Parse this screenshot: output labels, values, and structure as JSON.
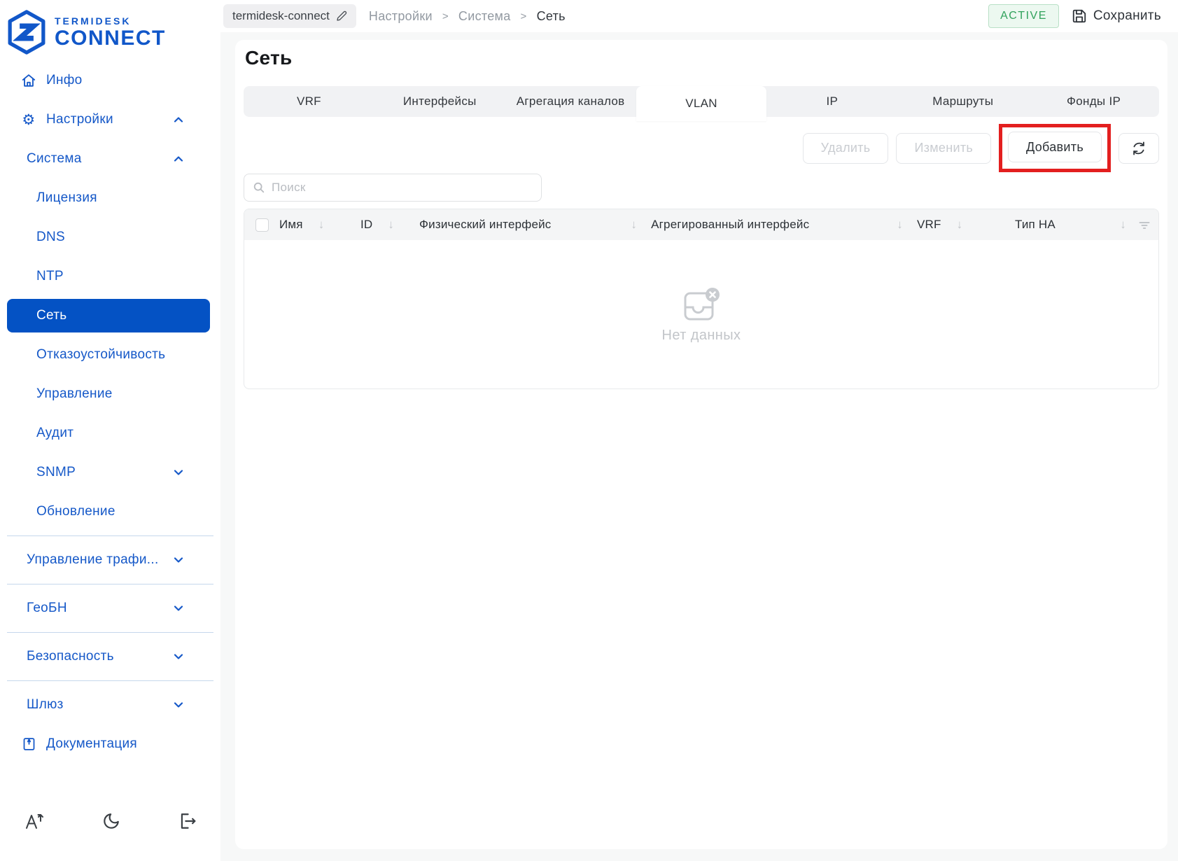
{
  "brand": {
    "name_top": "TERMIDESK",
    "name_bottom": "CONNECT"
  },
  "topbar": {
    "hostname": "termidesk-connect",
    "breadcrumbs": [
      "Настройки",
      "Система",
      "Сеть"
    ],
    "separator": ">",
    "status_badge": "ACTIVE",
    "save_label": "Сохранить"
  },
  "page": {
    "title": "Сеть"
  },
  "tabs": {
    "items": [
      "VRF",
      "Интерфейсы",
      "Агрегация каналов",
      "VLAN",
      "IP",
      "Маршруты",
      "Фонды IP"
    ],
    "active": "VLAN"
  },
  "toolbar": {
    "delete_label": "Удалить",
    "edit_label": "Изменить",
    "add_label": "Добавить"
  },
  "search": {
    "placeholder": "Поиск"
  },
  "table": {
    "columns": [
      "Имя",
      "ID",
      "Физический интерфейс",
      "Агрегированный интерфейс",
      "VRF",
      "Тип HA"
    ],
    "rows": [],
    "empty_text": "Нет данных"
  },
  "sidebar": {
    "items": [
      {
        "label": "Инфо"
      },
      {
        "label": "Настройки"
      },
      {
        "label": "Система"
      },
      {
        "label": "Лицензия"
      },
      {
        "label": "DNS"
      },
      {
        "label": "NTP"
      },
      {
        "label": "Сеть",
        "active": true
      },
      {
        "label": "Отказоустойчивость"
      },
      {
        "label": "Управление"
      },
      {
        "label": "Аудит"
      },
      {
        "label": "SNMP"
      },
      {
        "label": "Обновление"
      },
      {
        "label": "Управление трафи..."
      },
      {
        "label": "ГеоБН"
      },
      {
        "label": "Безопасность"
      },
      {
        "label": "Шлюз"
      },
      {
        "label": "Документация"
      }
    ]
  },
  "colors": {
    "brand_blue": "#1157c9",
    "active_item_bg": "#0452c4",
    "status_green": "#31a25c",
    "annotation_red": "#e31f1f"
  }
}
